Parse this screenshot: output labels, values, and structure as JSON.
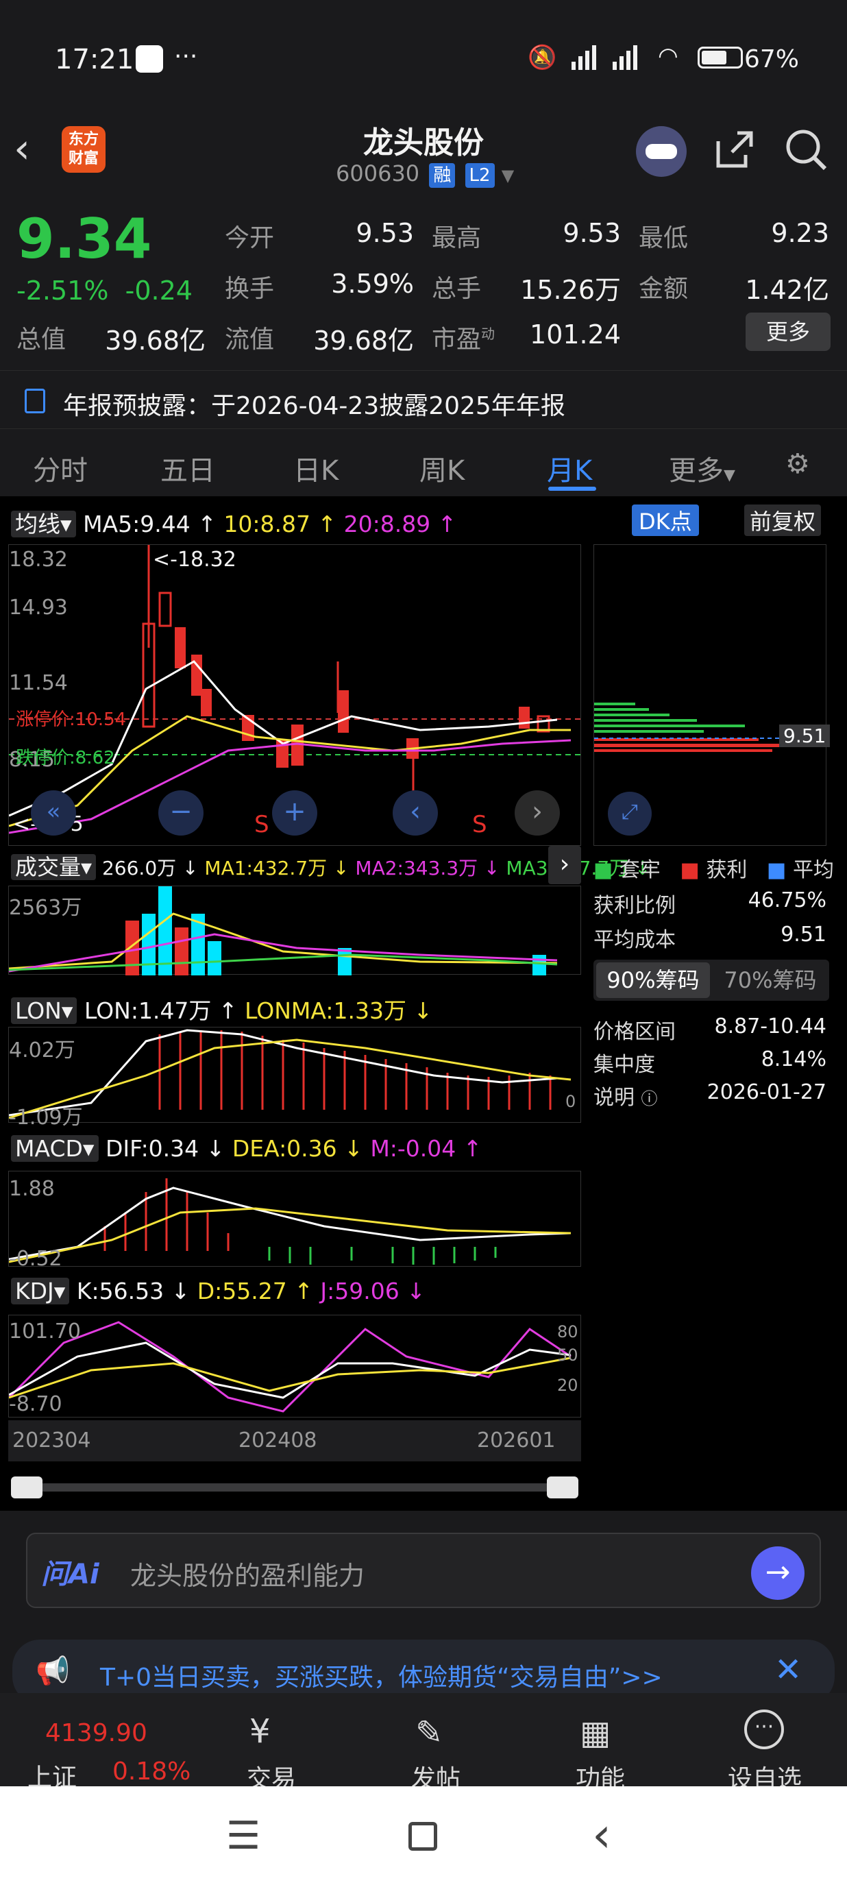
{
  "status_bar": {
    "time": "17:21",
    "dots": "···",
    "battery": "67%"
  },
  "header": {
    "logo_line1": "东方",
    "logo_line2": "财富",
    "title": "龙头股份",
    "code": "600630",
    "badge1": "融",
    "badge2": "L2"
  },
  "quote": {
    "price": "9.34",
    "change_pct": "-2.51%",
    "change_abs": "-0.24",
    "open_label": "今开",
    "open": "9.53",
    "high_label": "最高",
    "high": "9.53",
    "low_label": "最低",
    "low": "9.23",
    "turnover_label": "换手",
    "turnover": "3.59%",
    "volume_label": "总手",
    "volume": "15.26万",
    "amount_label": "金额",
    "amount": "1.42亿",
    "mktcap_label": "总值",
    "mktcap": "39.68亿",
    "float_label": "流值",
    "float": "39.68亿",
    "pe_label": "市盈",
    "pe_sup": "动",
    "pe": "101.24",
    "more": "更多"
  },
  "notice": "年报预披露：于2026-04-23披露2025年年报",
  "tabs": [
    "分时",
    "五日",
    "日K",
    "周K",
    "月K",
    "更多",
    "settings"
  ],
  "main_chart": {
    "ma_btn": "均线",
    "ma5": "MA5:9.44 ↑",
    "ma10": "10:8.87 ↑",
    "ma20": "20:8.89 ↑",
    "dk": "DK点",
    "adj": "前复权",
    "y_top": "18.32",
    "y2": "14.93",
    "y3": "11.54",
    "y4": "8.15",
    "y5": "4.75",
    "max_label": "<-18.32",
    "min_label": "<-4.75",
    "limit_up": "涨停价:10.54",
    "limit_down": "跌停价:8.62",
    "s1": "S",
    "s2": "S",
    "chip_price": "9.51"
  },
  "volume": {
    "btn": "成交量",
    "v": "266.0万 ↓",
    "ma1": "MA1:432.7万 ↓",
    "ma2": "MA2:343.3万 ↓",
    "ma3": "MA3:427.7万 ↓",
    "y_top": "2563万"
  },
  "lon": {
    "btn": "LON",
    "v": "LON:1.47万 ↑",
    "ma": "LONMA:1.33万 ↓",
    "y_top": "4.02万",
    "y_bot": "-1.09万",
    "zero": "0"
  },
  "macd": {
    "btn": "MACD",
    "dif": "DIF:0.34 ↓",
    "dea": "DEA:0.36 ↓",
    "m": "M:-0.04 ↑",
    "y_top": "1.88",
    "y_bot": "-0.52"
  },
  "kdj": {
    "btn": "KDJ",
    "k": "K:56.53 ↓",
    "d": "D:55.27 ↑",
    "j": "J:59.06 ↓",
    "y_top": "101.70",
    "y_bot": "-8.70",
    "r80": "80",
    "r50": "50",
    "r20": "20"
  },
  "x_axis": [
    "202304",
    "202408",
    "202601"
  ],
  "chips": {
    "legend_1": "套牢",
    "legend_2": "获利",
    "legend_3": "平均",
    "profit_label": "获利比例",
    "profit": "46.75%",
    "cost_label": "平均成本",
    "cost": "9.51",
    "tab90": "90%筹码",
    "tab70": "70%筹码",
    "range_label": "价格区间",
    "range": "8.87-10.44",
    "conc_label": "集中度",
    "conc": "8.14%",
    "note_label": "说明",
    "note": "2026-01-27"
  },
  "ai": {
    "logo": "问Ai",
    "placeholder": "龙头股份的盈利能力"
  },
  "banner": "T+0当日买卖，买涨买跌，体验期货“交易自由”>>",
  "bottom_nav": {
    "index_value": "4139.90",
    "index_name": "上证",
    "index_pct": "0.18%",
    "trade": "交易",
    "post": "发帖",
    "func": "功能",
    "watch": "设自选"
  },
  "colors": {
    "up": "#e5302b",
    "down": "#2fc64a",
    "accent": "#3d8bff"
  }
}
